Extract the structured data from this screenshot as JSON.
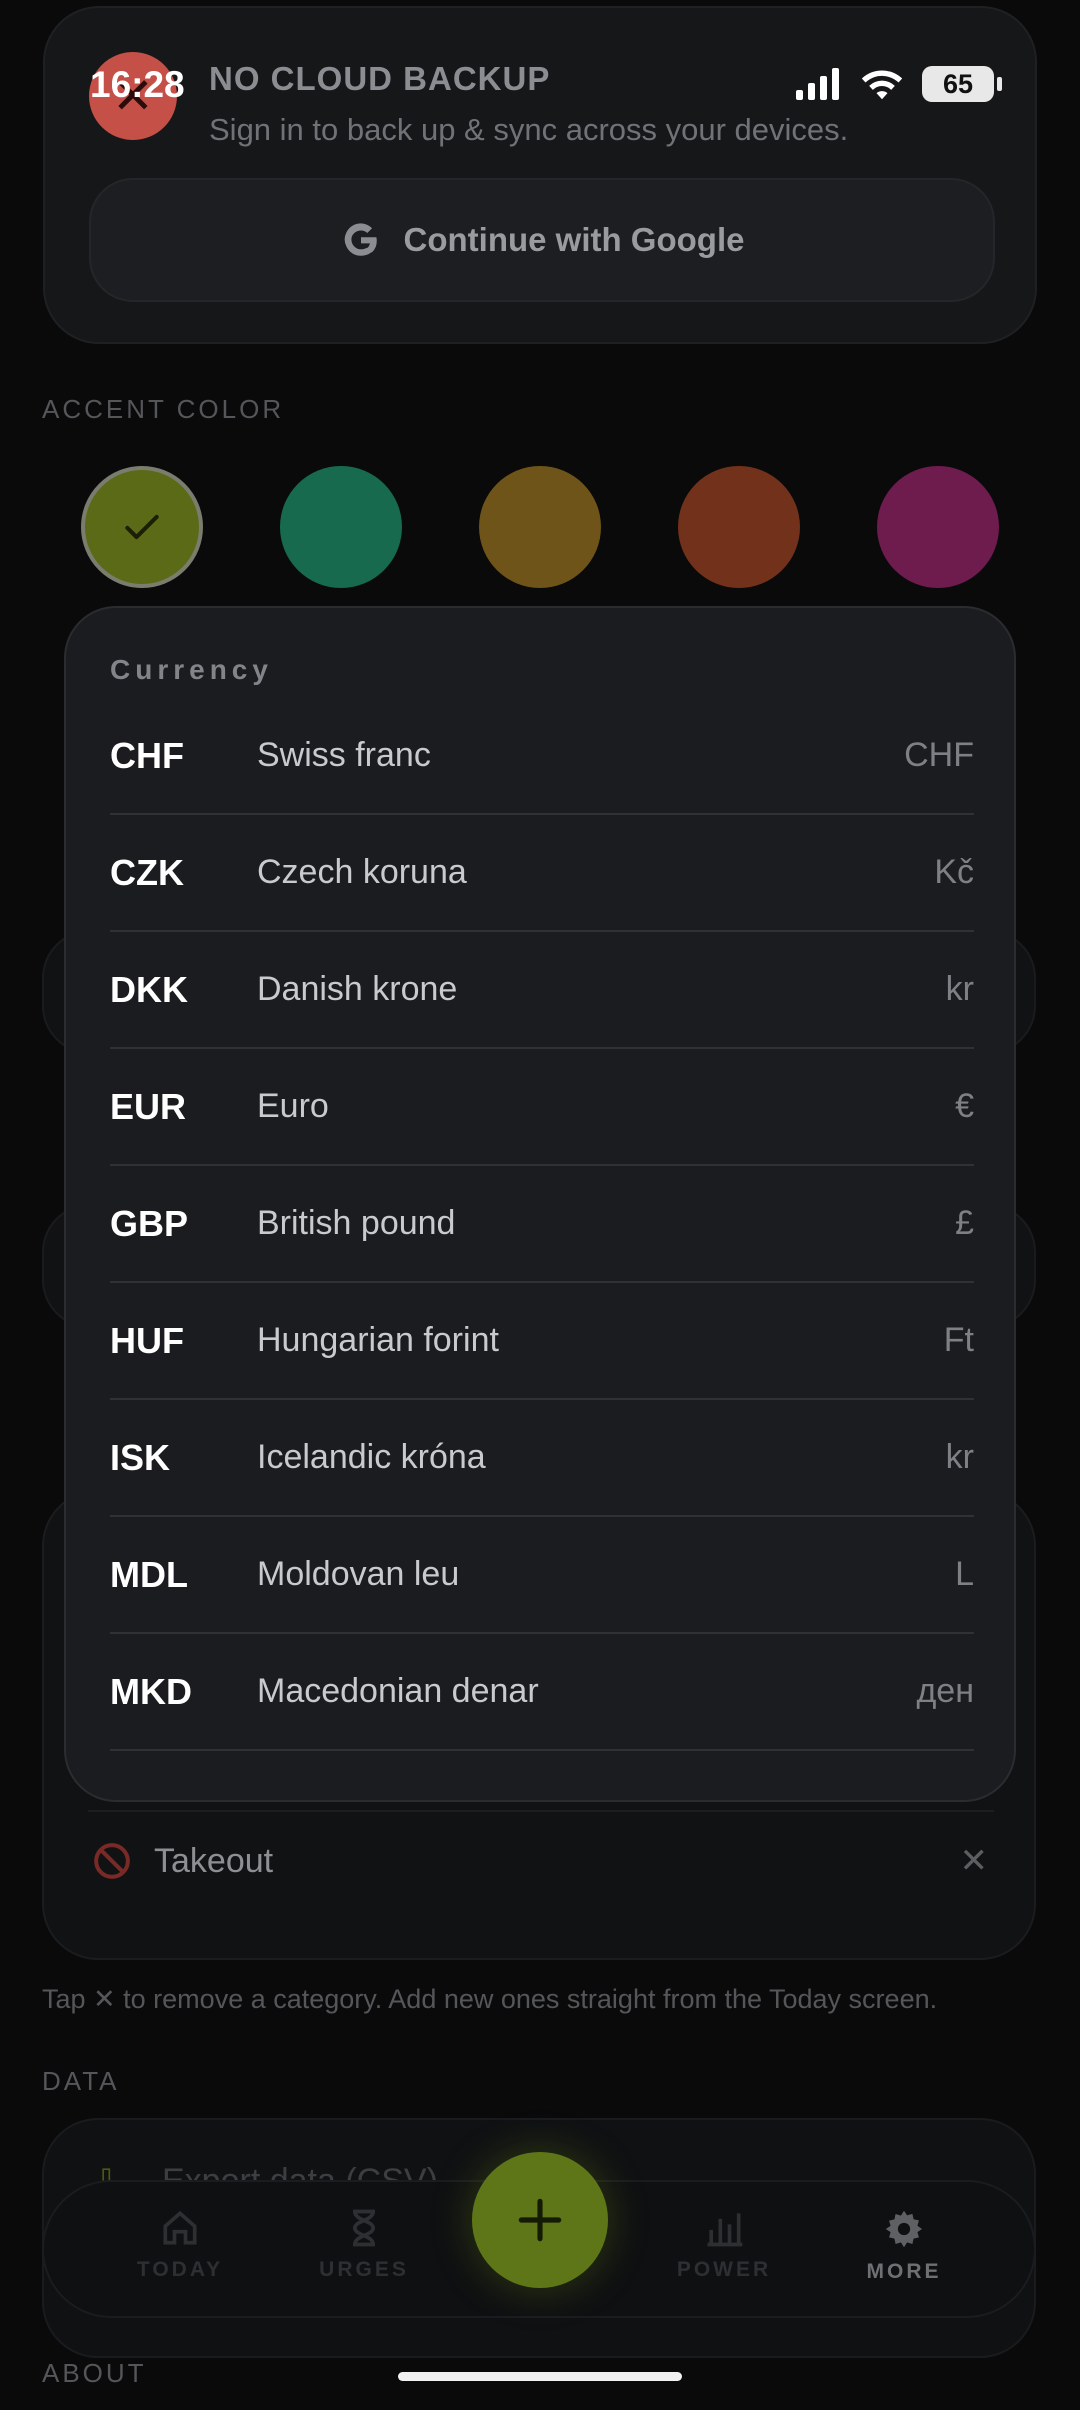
{
  "status_bar": {
    "time": "16:28",
    "battery": "65"
  },
  "backup": {
    "title": "NO CLOUD BACKUP",
    "subtitle": "Sign in to back up & sync across your devices.",
    "google_button": "Continue with Google"
  },
  "accent": {
    "label": "ACCENT COLOR",
    "swatches": [
      {
        "color": "#5a6a16",
        "selected": true
      },
      {
        "color": "#176a4e",
        "selected": false
      },
      {
        "color": "#6e5418",
        "selected": false
      },
      {
        "color": "#72311a",
        "selected": false
      },
      {
        "color": "#6e1b4e",
        "selected": false
      }
    ]
  },
  "categories": {
    "takeout_label": "Takeout",
    "hint": "Tap ✕ to remove a category. Add new ones straight from the Today screen."
  },
  "data_section": {
    "label": "DATA",
    "export_label": "Export data (CSV)"
  },
  "about_label": "ABOUT",
  "nav": {
    "today": "TODAY",
    "urges": "URGES",
    "power": "POWER",
    "more": "MORE"
  },
  "currency_sheet": {
    "title": "Currency",
    "items": [
      {
        "code": "CHF",
        "name": "Swiss franc",
        "symbol": "CHF"
      },
      {
        "code": "CZK",
        "name": "Czech koruna",
        "symbol": "Kč"
      },
      {
        "code": "DKK",
        "name": "Danish krone",
        "symbol": "kr"
      },
      {
        "code": "EUR",
        "name": "Euro",
        "symbol": "€"
      },
      {
        "code": "GBP",
        "name": "British pound",
        "symbol": "£"
      },
      {
        "code": "HUF",
        "name": "Hungarian forint",
        "symbol": "Ft"
      },
      {
        "code": "ISK",
        "name": "Icelandic króna",
        "symbol": "kr"
      },
      {
        "code": "MDL",
        "name": "Moldovan leu",
        "symbol": "L"
      },
      {
        "code": "MKD",
        "name": "Macedonian denar",
        "symbol": "ден"
      }
    ]
  }
}
